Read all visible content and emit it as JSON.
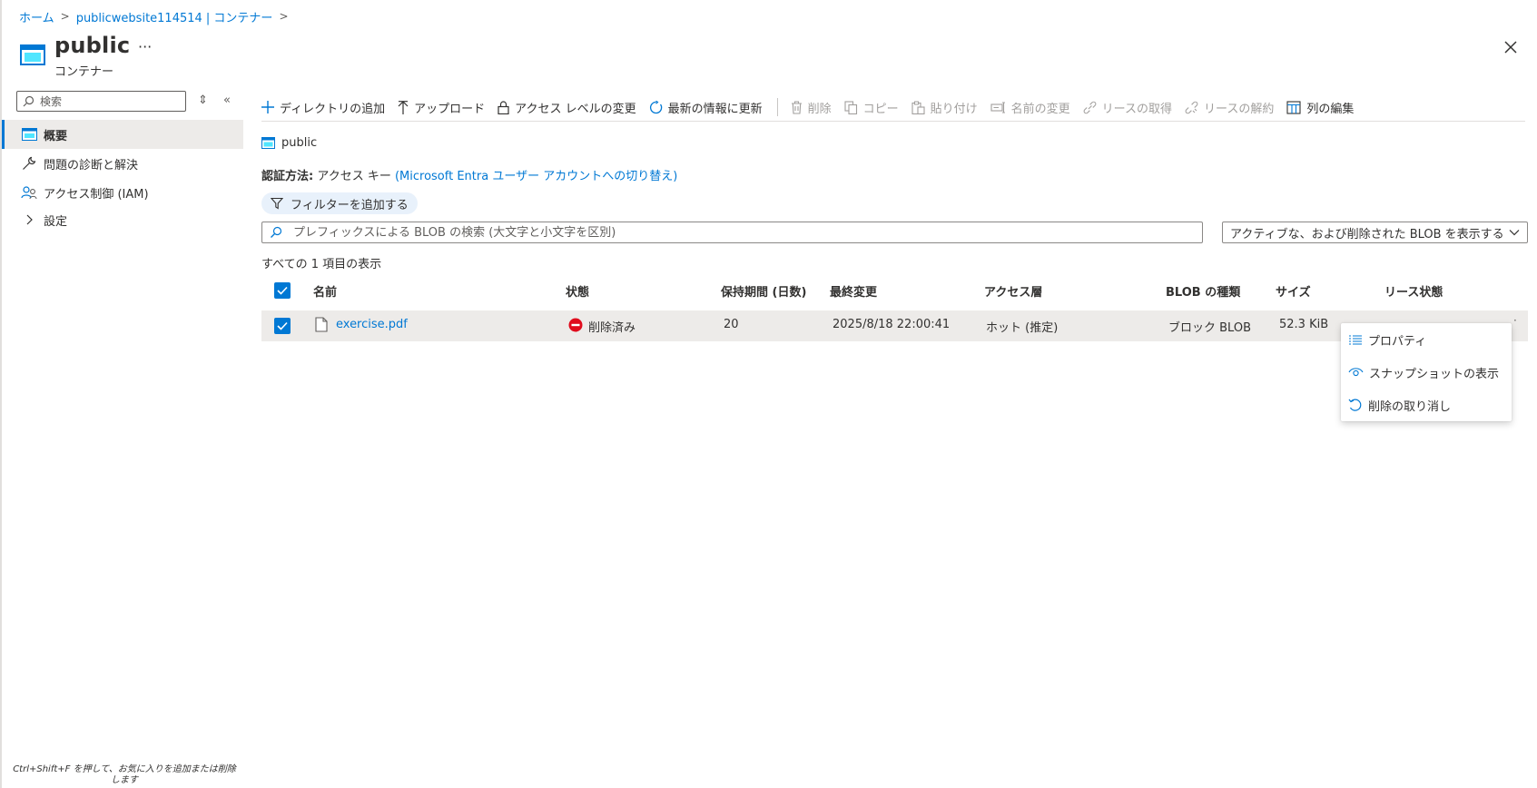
{
  "breadcrumb": {
    "home": "ホーム",
    "account": "publicwebsite114514 | コンテナー"
  },
  "header": {
    "title": "public",
    "subtitle": "コンテナー",
    "more": "···"
  },
  "side": {
    "search_placeholder": "検索",
    "items": [
      {
        "label": "概要",
        "icon": "overview-icon"
      },
      {
        "label": "問題の診断と解決",
        "icon": "wrench-icon"
      },
      {
        "label": "アクセス制御 (IAM)",
        "icon": "people-icon"
      },
      {
        "label": "設定",
        "icon": "chevron-right-icon"
      }
    ],
    "footer_note": "Ctrl+Shift+F を押して、お気に入りを追加または削除します"
  },
  "toolbar": {
    "add_directory": "ディレクトリの追加",
    "upload": "アップロード",
    "change_access_level": "アクセス レベルの変更",
    "refresh": "最新の情報に更新",
    "delete": "削除",
    "copy": "コピー",
    "paste": "貼り付け",
    "rename": "名前の変更",
    "acquire_lease": "リースの取得",
    "break_lease": "リースの解約",
    "edit_columns": "列の編集"
  },
  "content": {
    "container_name": "public",
    "auth_label": "認証方法:",
    "auth_value": "アクセス キー",
    "auth_switch_link": "(Microsoft Entra ユーザー アカウントへの切り替え)",
    "add_filter": "フィルターを追加する",
    "search_placeholder": "プレフィックスによる BLOB の検索 (大文字と小文字を区別)",
    "view_option": "アクティブな、および削除された BLOB を表示する",
    "count_text": "すべての 1 項目の表示"
  },
  "table": {
    "columns": {
      "name": "名前",
      "status": "状態",
      "retention": "保持期間 (日数)",
      "modified": "最終変更",
      "tier": "アクセス層",
      "blob_type": "BLOB の種類",
      "size": "サイズ",
      "lease": "リース状態"
    },
    "rows": [
      {
        "name": "exercise.pdf",
        "status": "削除済み",
        "retention": "20",
        "modified": "2025/8/18 22:00:41",
        "tier": "ホット (推定)",
        "blob_type": "ブロック BLOB",
        "size": "52.3 KiB"
      }
    ]
  },
  "context_menu": {
    "properties": "プロパティ",
    "view_snapshots": "スナップショットの表示",
    "undelete": "削除の取り消し"
  },
  "colors": {
    "accent": "#0078d4",
    "deleted_status": "#e00b1c",
    "selected_row": "#edebe9"
  }
}
